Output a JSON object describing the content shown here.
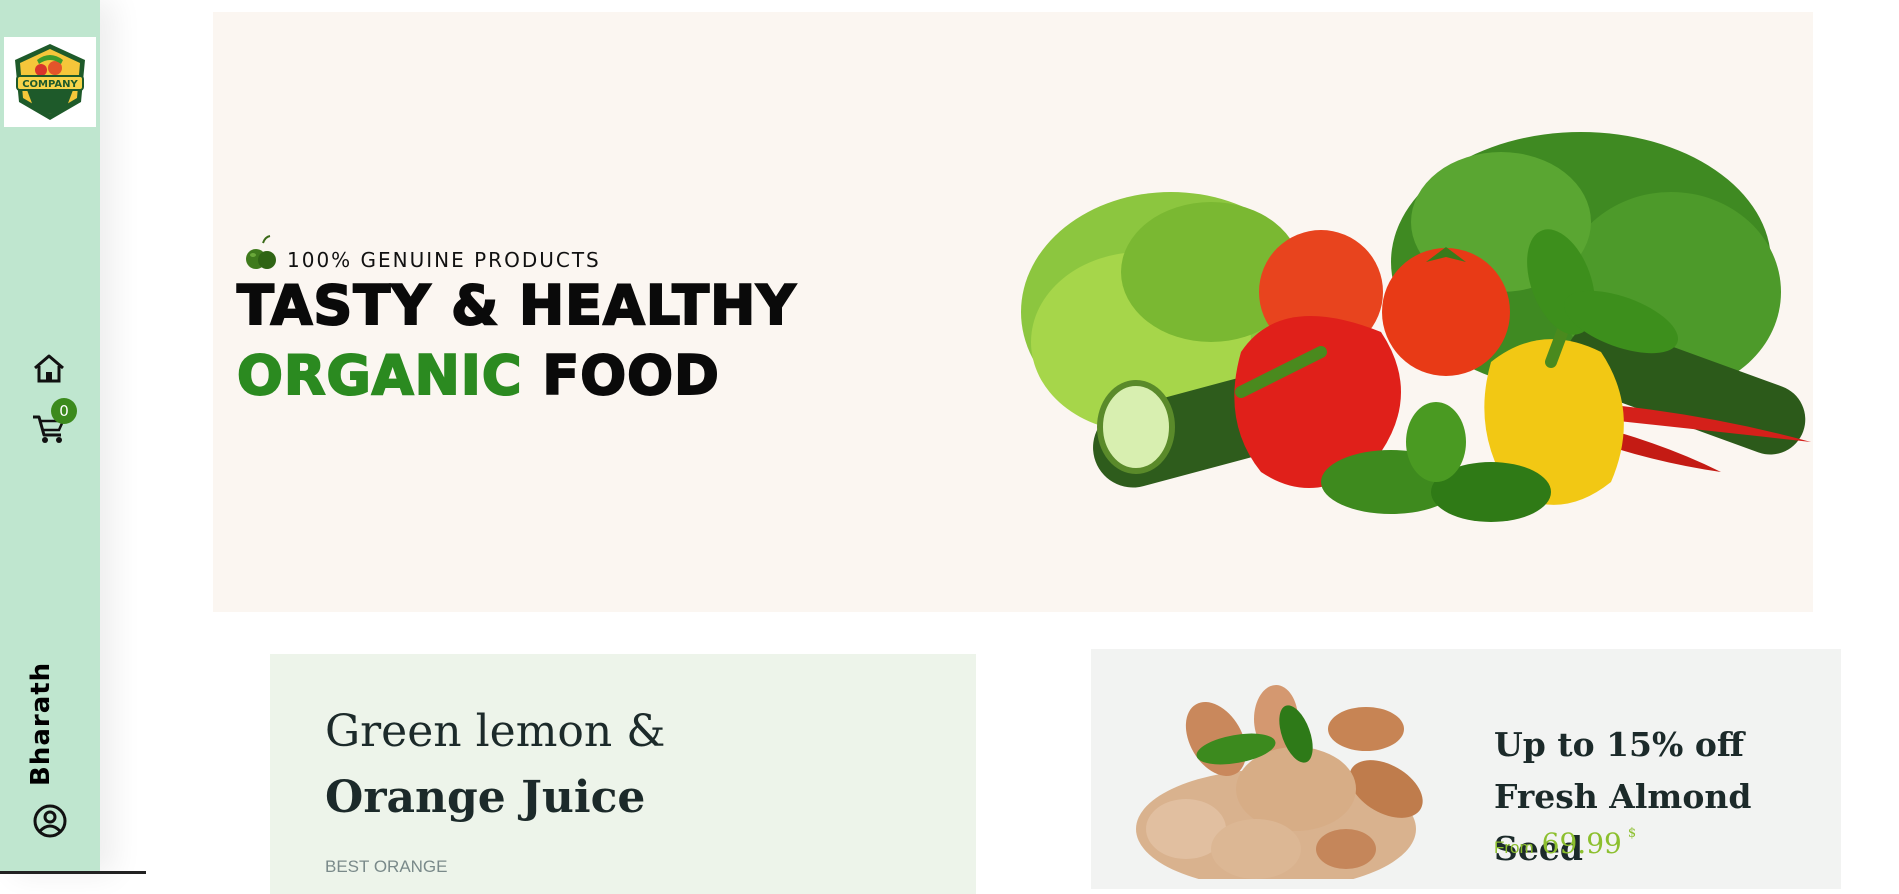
{
  "sidebar": {
    "logo_text": "COMPANY",
    "cart_count": "0",
    "user_name": "Bharath"
  },
  "hero": {
    "tagline": "100% GENUINE PRODUCTS",
    "title_line1": "TASTY & HEALTHY",
    "title_line2_highlight": "ORGANIC",
    "title_line2_rest": "FOOD"
  },
  "promo_left": {
    "line1": "Green lemon &",
    "line2": "Orange Juice",
    "sub": "BEST ORANGE"
  },
  "promo_right": {
    "title": "Up to 15% off Fresh Almond Seed",
    "from_label": "From",
    "price": "69.99",
    "currency": "$"
  },
  "colors": {
    "sidebar_bg": "#bfe6cf",
    "accent_green": "#2b8a20",
    "price_green": "#8cbf2e"
  },
  "icons": [
    "company-logo",
    "home-icon",
    "cart-icon",
    "user-icon",
    "apple-icon"
  ]
}
